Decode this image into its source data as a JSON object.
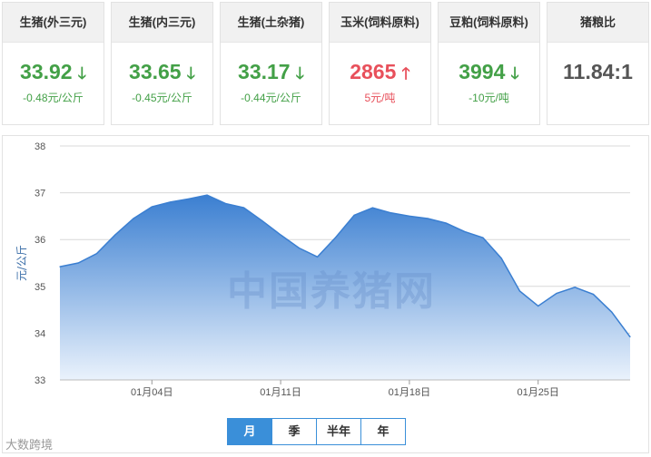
{
  "cards": [
    {
      "title": "生猪(外三元)",
      "price": "33.92",
      "dir": "down",
      "change": "-0.48元/公斤",
      "color": "green"
    },
    {
      "title": "生猪(内三元)",
      "price": "33.65",
      "dir": "down",
      "change": "-0.45元/公斤",
      "color": "green"
    },
    {
      "title": "生猪(土杂猪)",
      "price": "33.17",
      "dir": "down",
      "change": "-0.44元/公斤",
      "color": "green"
    },
    {
      "title": "玉米(饲料原料)",
      "price": "2865",
      "dir": "up",
      "change": "5元/吨",
      "color": "red"
    },
    {
      "title": "豆粕(饲料原料)",
      "price": "3994",
      "dir": "down",
      "change": "-10元/吨",
      "color": "green"
    },
    {
      "title": "猪粮比",
      "price": "11.84:1",
      "dir": "",
      "change": "",
      "color": "grey"
    }
  ],
  "arrows": {
    "down": "🡓",
    "up": "🡑"
  },
  "watermark": "中国养猪网",
  "periods": [
    "月",
    "季",
    "半年",
    "年"
  ],
  "selected_period": "月",
  "logo_text": "大数跨境",
  "chart_data": {
    "type": "area",
    "title": "",
    "xlabel": "",
    "ylabel": "元/公斤",
    "ylim": [
      33,
      38
    ],
    "yticks": [
      33,
      34,
      35,
      36,
      37,
      38
    ],
    "x_tick_labels": [
      "01月04日",
      "01月11日",
      "01月18日",
      "01月25日"
    ],
    "x_tick_index": [
      5,
      12,
      19,
      26
    ],
    "grid": true,
    "colors": {
      "line": "#3b7fd1",
      "fill_top": "#3b7fd1",
      "fill_bottom": "#eaf2fc"
    },
    "values": [
      35.42,
      35.5,
      35.7,
      36.1,
      36.45,
      36.7,
      36.8,
      36.87,
      36.95,
      36.77,
      36.68,
      36.4,
      36.1,
      35.82,
      35.63,
      36.05,
      36.52,
      36.68,
      36.57,
      36.5,
      36.45,
      36.35,
      36.17,
      36.04,
      35.6,
      34.9,
      34.58,
      34.85,
      34.98,
      34.83,
      34.45,
      33.92
    ]
  }
}
